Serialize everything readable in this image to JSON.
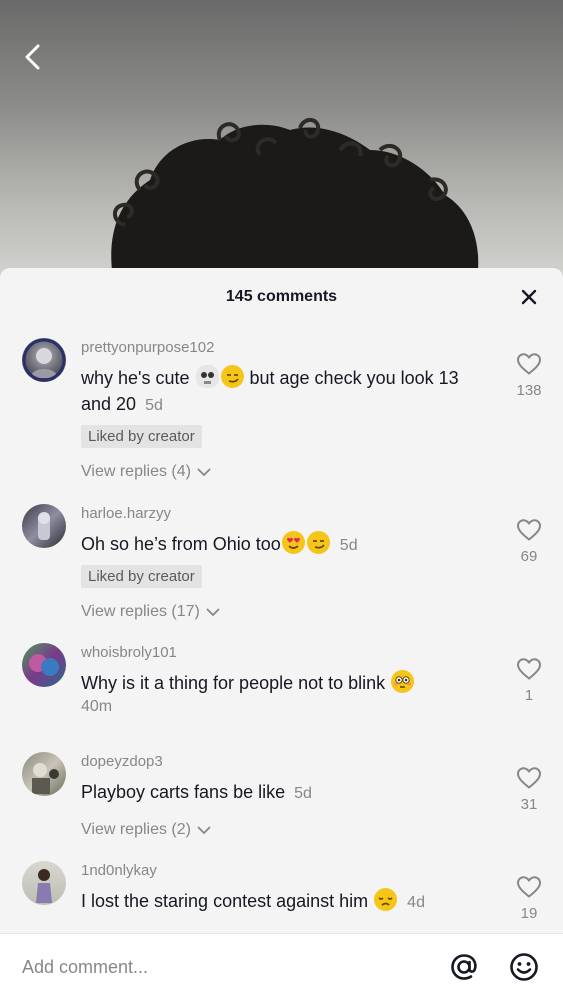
{
  "header": {
    "comment_count": "145 comments"
  },
  "comments": [
    {
      "username": "prettyonpurpose102",
      "text_before": "why he's cute ",
      "emoji_1": "skull-emoji",
      "emoji_2": "smirking-face-emoji",
      "text_after": " but age check you look 13 and 20",
      "time": "5d",
      "badge": "Liked by creator",
      "replies": "View replies (4)",
      "likes": "138"
    },
    {
      "username": "harloe.harzyy",
      "text_before": "Oh so he’s from Ohio too",
      "emoji_1": "heart-eyes-emoji",
      "emoji_2": "smirking-face-emoji",
      "time": "5d",
      "badge": "Liked by creator",
      "replies": "View replies (17)",
      "likes": "69"
    },
    {
      "username": "whoisbroly101",
      "text_before": "Why is it a thing for people not to blink ",
      "emoji_1": "flushed-face-emoji",
      "time": "40m",
      "likes": "1"
    },
    {
      "username": "dopeyzdop3",
      "text_before": "Playboy carts fans be like",
      "time": "5d",
      "replies": "View replies (2)",
      "likes": "31"
    },
    {
      "username": "1nd0nlykay",
      "text_before": "I lost the staring contest against him ",
      "emoji_1": "disappointed-face-emoji",
      "time": "4d",
      "likes": "19"
    }
  ],
  "footer": {
    "placeholder": "Add comment..."
  },
  "colors": {
    "sheet_bg": "#f4f4f4",
    "primary_text": "#161823",
    "secondary_text": "#86878b"
  }
}
